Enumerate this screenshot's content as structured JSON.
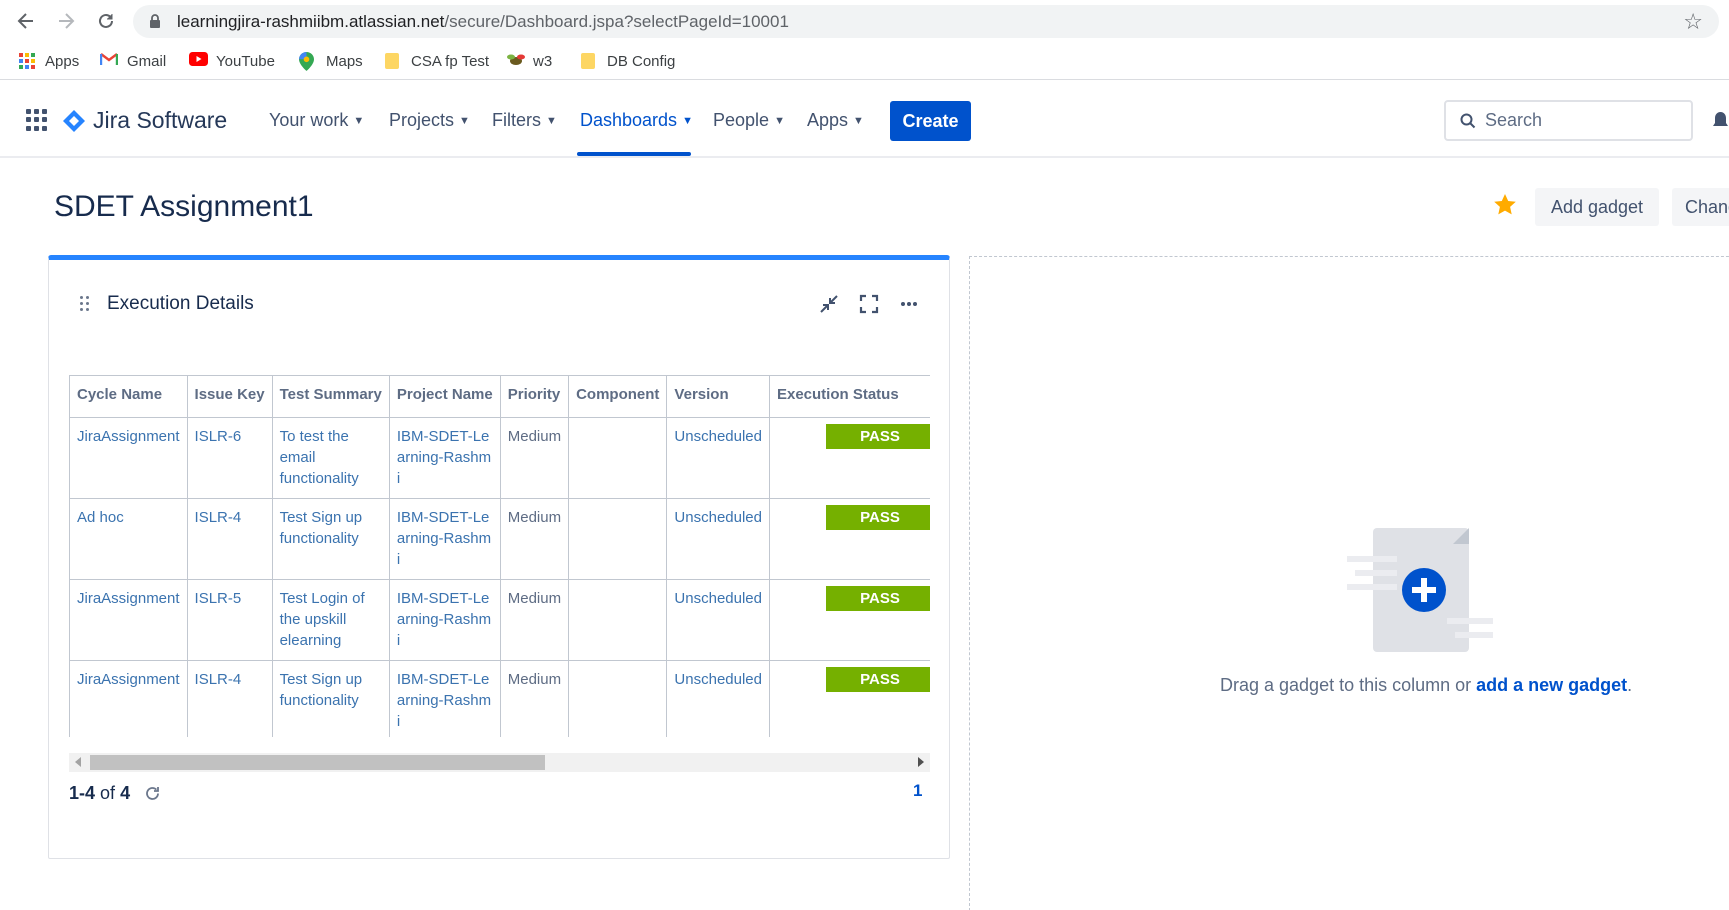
{
  "browser": {
    "url_host": "learningjira-rashmiibm.atlassian.net",
    "url_path": "/secure/Dashboard.jspa?selectPageId=10001",
    "bookmarks": [
      {
        "label": "Apps",
        "icon": "apps-grid-icon"
      },
      {
        "label": "Gmail",
        "icon": "gmail-icon"
      },
      {
        "label": "YouTube",
        "icon": "youtube-icon"
      },
      {
        "label": "Maps",
        "icon": "maps-icon"
      },
      {
        "label": "CSA fp Test",
        "icon": "folder-icon"
      },
      {
        "label": "w3",
        "icon": "bee-icon"
      },
      {
        "label": "DB Config",
        "icon": "folder-icon"
      }
    ]
  },
  "header": {
    "product": "Jira Software",
    "nav": [
      {
        "label": "Your work"
      },
      {
        "label": "Projects"
      },
      {
        "label": "Filters"
      },
      {
        "label": "Dashboards"
      },
      {
        "label": "People"
      },
      {
        "label": "Apps"
      }
    ],
    "active_nav": "Dashboards",
    "create_label": "Create",
    "search_placeholder": "Search"
  },
  "page": {
    "title": "SDET Assignment1",
    "add_gadget_label": "Add gadget",
    "change_label": "Change"
  },
  "gadget": {
    "title": "Execution Details",
    "columns": [
      "Cycle Name",
      "Issue Key",
      "Test Summary",
      "Project Name",
      "Priority",
      "Component",
      "Version",
      "Execution Status"
    ],
    "rows": [
      {
        "cycle": "JiraAssignment",
        "issue": "ISLR-6",
        "summary": "To test the email functionality",
        "project": "IBM-SDET-Learning-Rashmi",
        "priority": "Medium",
        "component": "",
        "version": "Unscheduled",
        "status": "PASS"
      },
      {
        "cycle": "Ad hoc",
        "issue": "ISLR-4",
        "summary": "Test Sign up functionality",
        "project": "IBM-SDET-Learning-Rashmi",
        "priority": "Medium",
        "component": "",
        "version": "Unscheduled",
        "status": "PASS"
      },
      {
        "cycle": "JiraAssignment",
        "issue": "ISLR-5",
        "summary": "Test Login of the upskill elearning",
        "project": "IBM-SDET-Learning-Rashmi",
        "priority": "Medium",
        "component": "",
        "version": "Unscheduled",
        "status": "PASS"
      },
      {
        "cycle": "JiraAssignment",
        "issue": "ISLR-4",
        "summary": "Test Sign up functionality",
        "project": "IBM-SDET-Learning-Rashmi",
        "priority": "Medium",
        "component": "",
        "version": "Unscheduled",
        "status": "PASS"
      }
    ],
    "pager_range": "1-4",
    "pager_of": "of",
    "pager_total": "4",
    "current_page": "1",
    "status_color": "#75b000"
  },
  "empty_column": {
    "text": "Drag a gadget to this column or ",
    "link": "add a new gadget",
    "suffix": "."
  },
  "colors": {
    "accent": "#0052cc",
    "gadget_top_border": "#2684ff"
  }
}
